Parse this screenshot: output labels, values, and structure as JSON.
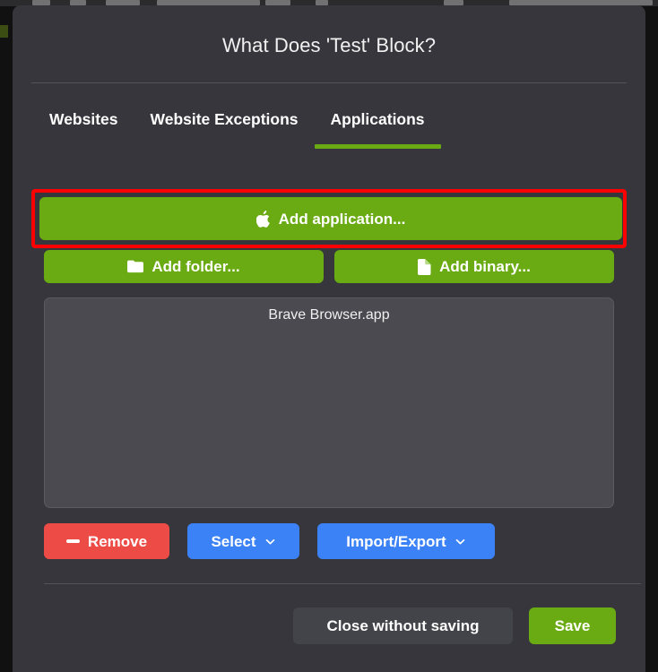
{
  "background": {
    "toolbar_visible": true,
    "sliver_color": "#3c4d14"
  },
  "dialog": {
    "title": "What Does 'Test' Block?",
    "background_color": "#36363c"
  },
  "tabs": [
    {
      "label": "Websites",
      "active": false
    },
    {
      "label": "Website Exceptions",
      "active": false
    },
    {
      "label": "Applications",
      "active": true
    }
  ],
  "accent_colors": {
    "green": "#6aab13",
    "blue": "#3b82f6",
    "red": "#ed4b45",
    "grey": "#43434a",
    "highlight_box": "#fe0000"
  },
  "actions": {
    "add_application": {
      "label": "Add application...",
      "icon": "apple-icon",
      "highlighted": true
    },
    "add_folder": {
      "label": "Add folder...",
      "icon": "folder-icon"
    },
    "add_binary": {
      "label": "Add binary...",
      "icon": "document-icon"
    }
  },
  "list": {
    "items": [
      {
        "name": "Brave Browser.app"
      }
    ]
  },
  "tools": {
    "remove": {
      "label": "Remove",
      "icon": "minus-icon"
    },
    "select": {
      "label": "Select",
      "icon": "chevron-down-icon"
    },
    "import_export": {
      "label": "Import/Export",
      "icon": "chevron-down-icon"
    }
  },
  "footer": {
    "close": "Close without saving",
    "save": "Save"
  }
}
